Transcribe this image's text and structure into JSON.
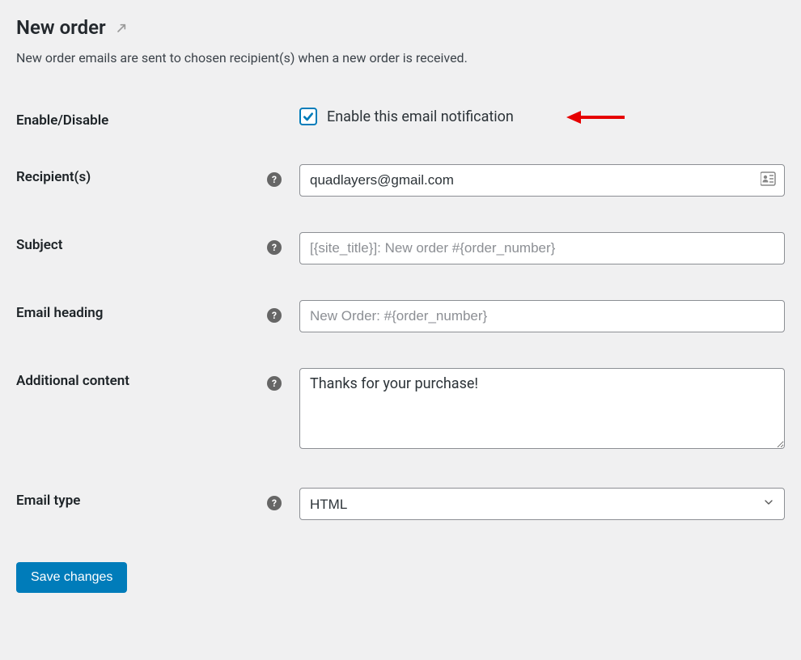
{
  "header": {
    "title": "New order",
    "description": "New order emails are sent to chosen recipient(s) when a new order is received."
  },
  "fields": {
    "enable": {
      "label": "Enable/Disable",
      "checkbox_label": "Enable this email notification",
      "checked": true
    },
    "recipients": {
      "label": "Recipient(s)",
      "value": "quadlayers@gmail.com",
      "placeholder": ""
    },
    "subject": {
      "label": "Subject",
      "value": "",
      "placeholder": "[{site_title}]: New order #{order_number}"
    },
    "email_heading": {
      "label": "Email heading",
      "value": "",
      "placeholder": "New Order: #{order_number}"
    },
    "additional_content": {
      "label": "Additional content",
      "value": "Thanks for your purchase!"
    },
    "email_type": {
      "label": "Email type",
      "value": "HTML"
    }
  },
  "actions": {
    "save": "Save changes"
  }
}
